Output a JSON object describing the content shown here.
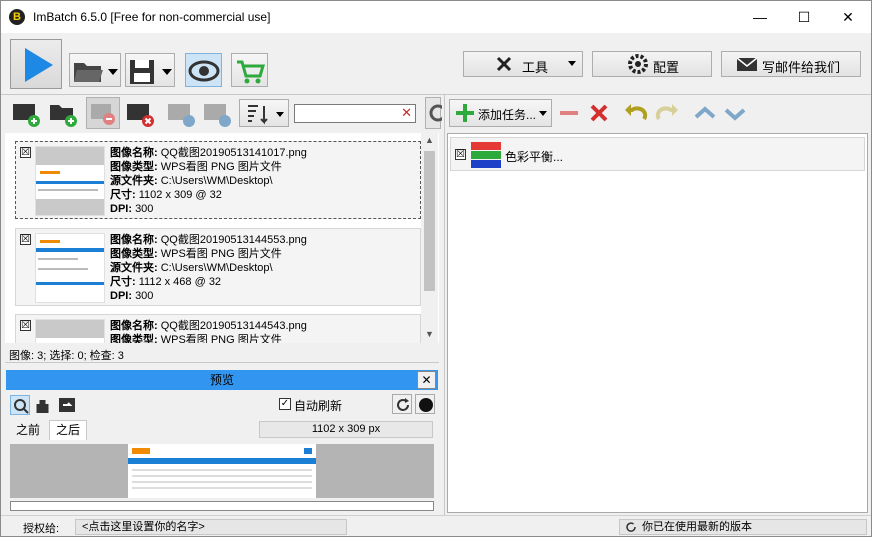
{
  "window": {
    "title": "ImBatch 6.5.0 [Free for non-commercial use]",
    "app_icon_letter": "B",
    "minimize": "—",
    "maximize": "☐",
    "close": "✕"
  },
  "toolbar_right": {
    "tools_label": "工具",
    "settings_label": "配置",
    "mail_label": "写邮件给我们"
  },
  "images": [
    {
      "checked": "☒",
      "name_label": "图像名称:",
      "name": "QQ截图20190513141017.png",
      "type_label": "图像类型:",
      "type": "WPS看图 PNG 图片文件",
      "folder_label": "源文件夹:",
      "folder": "C:\\Users\\WM\\Desktop\\",
      "size_label": "尺寸:",
      "size": "1102 x 309 @ 32",
      "dpi_label": "DPI:",
      "dpi": "300"
    },
    {
      "checked": "☒",
      "name_label": "图像名称:",
      "name": "QQ截图20190513144553.png",
      "type_label": "图像类型:",
      "type": "WPS看图 PNG 图片文件",
      "folder_label": "源文件夹:",
      "folder": "C:\\Users\\WM\\Desktop\\",
      "size_label": "尺寸:",
      "size": "1112 x 468 @ 32",
      "dpi_label": "DPI:",
      "dpi": "300"
    },
    {
      "checked": "☒",
      "name_label": "图像名称:",
      "name": "QQ截图20190513144543.png",
      "type_label": "图像类型:",
      "type": "WPS看图 PNG 图片文件"
    }
  ],
  "image_status": "图像: 3; 选择: 0; 检查: 3",
  "preview": {
    "title": "预览",
    "auto_refresh_label": "自动刷新",
    "tab_before": "之前",
    "tab_after": "之后",
    "dimension": "1102 x 309 px"
  },
  "tasks": {
    "add_label": "添加任务...",
    "items": [
      {
        "checked": "☒",
        "label": "色彩平衡..."
      }
    ]
  },
  "statusbar": {
    "license_label": "授权给:",
    "license_value": "<点击这里设置你的名字>",
    "update_status": "你已在使用最新的版本"
  },
  "colors": {
    "play_blue": "#1e88e5",
    "preview_header": "#3296f0",
    "cart_green": "#2eaa3c",
    "remove_red": "#d32f2f"
  }
}
